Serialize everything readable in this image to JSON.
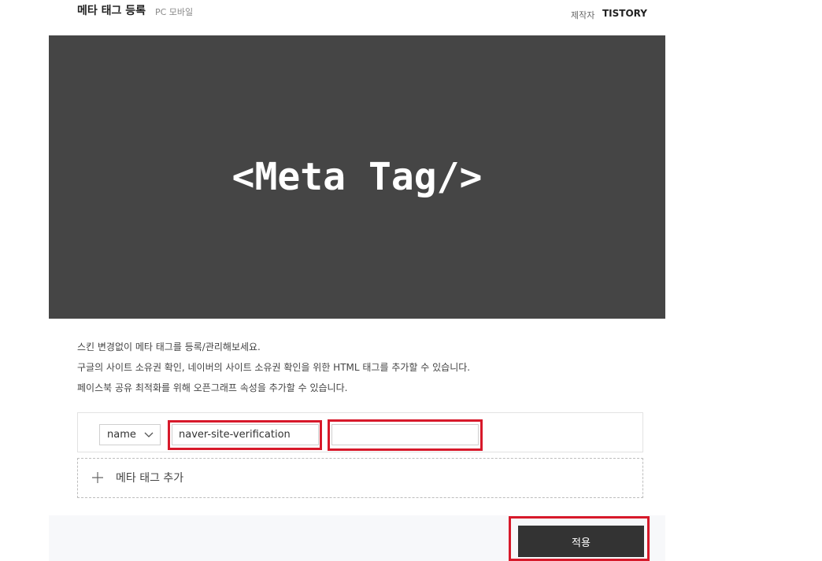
{
  "header": {
    "title": "메타 태그 등록",
    "subtitle": "PC 모바일",
    "maker_label": "제작자",
    "maker_value": "TISTORY"
  },
  "banner": {
    "text": "<Meta Tag/>"
  },
  "description": [
    "스킨 변경없이 메타 태그를 등록/관리해보세요.",
    "구글의 사이트 소유권 확인, 네이버의 사이트 소유권 확인을 위한 HTML 태그를 추가할 수 있습니다.",
    "페이스북 공유 최적화를 위해 오픈그래프 속성을 추가할 수 있습니다."
  ],
  "meta_row": {
    "attribute_select": "name",
    "name_value": "naver-site-verification",
    "content_value": ""
  },
  "add_tag_label": "메타 태그 추가",
  "apply_label": "적용",
  "colors": {
    "highlight": "#d7192a",
    "banner_bg": "#454545",
    "button_bg": "#333333"
  },
  "icons": {
    "select": "chevron-down-icon",
    "add": "plus-icon"
  }
}
